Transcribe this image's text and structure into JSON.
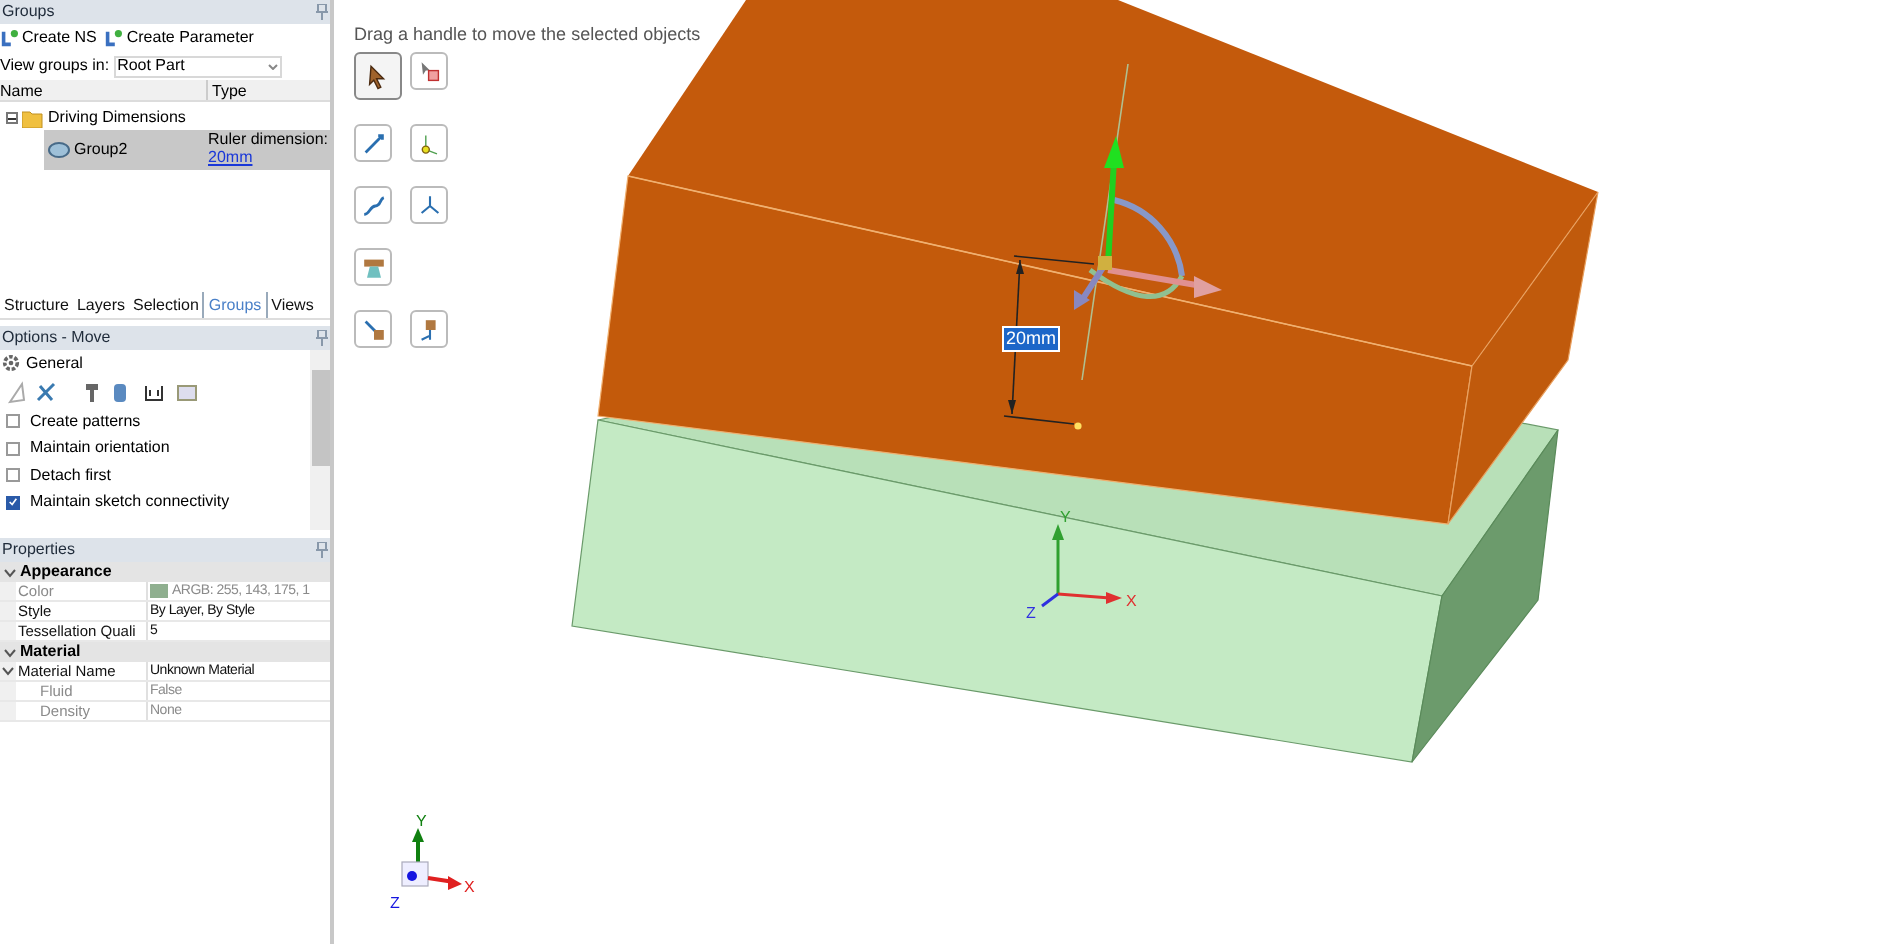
{
  "groups_panel": {
    "title": "Groups",
    "toolbar": [
      "Create NS",
      "Create Parameter"
    ],
    "view_groups_in": {
      "label": "View groups in:",
      "value": "Root Part"
    },
    "columns": [
      "Name",
      "Type"
    ],
    "tree": [
      {
        "name": "Driving Dimensions",
        "expanded": true,
        "children": [
          {
            "name": "Group2",
            "selected": true,
            "type": "Ruler dimension:",
            "link": "20mm"
          }
        ]
      }
    ]
  },
  "tabs": [
    {
      "label": "Structure",
      "selected": false
    },
    {
      "label": "Layers",
      "selected": false
    },
    {
      "label": "Selection",
      "selected": false
    },
    {
      "label": "Groups",
      "selected": true
    },
    {
      "label": "Views",
      "selected": false
    }
  ],
  "options_panel": {
    "title": "Options - Move",
    "section": "General",
    "checkboxes": [
      {
        "label": "Create patterns",
        "checked": false
      },
      {
        "label": "Maintain orientation",
        "checked": false
      },
      {
        "label": "Detach first",
        "checked": false
      },
      {
        "label": "Maintain sketch connectivity",
        "checked": true
      }
    ]
  },
  "properties": {
    "title": "Properties",
    "categories": [
      {
        "name": "Appearance",
        "expanded": true,
        "rows": [
          {
            "name": "Color",
            "value": "ARGB: 255, 143, 175, 1",
            "color": "#8faf8f",
            "disabled": true
          },
          {
            "name": "Style",
            "value": "By Layer, By Style",
            "disabled": false
          },
          {
            "name": "Tessellation Quali",
            "value": "5",
            "disabled": false
          }
        ]
      },
      {
        "name": "Material",
        "expanded": true,
        "rows": [
          {
            "name": "Material Name",
            "value": "Unknown Material",
            "disabled": false,
            "expanded": true,
            "children": [
              {
                "name": "Fluid",
                "value": "False",
                "disabled": true
              },
              {
                "name": "Density",
                "value": "None",
                "disabled": true
              }
            ]
          }
        ]
      }
    ]
  },
  "viewport": {
    "hint": "Drag a handle to move the selected objects",
    "tools": [
      {
        "kind": "select",
        "selected": true
      },
      {
        "kind": "select-body",
        "selected": false
      },
      {
        "kind": "along-line",
        "selected": false
      },
      {
        "kind": "origin",
        "selected": false
      },
      {
        "kind": "along-path",
        "selected": false
      },
      {
        "kind": "axes",
        "selected": false
      },
      {
        "kind": "anchor",
        "selected": false
      },
      {
        "kind": "to-object",
        "selected": false
      },
      {
        "kind": "up-to",
        "selected": false
      }
    ],
    "dimension_label": "20mm",
    "model_axes": [
      "Y",
      "X",
      "Z"
    ],
    "triad_axes": [
      "Y",
      "X",
      "Z"
    ]
  }
}
